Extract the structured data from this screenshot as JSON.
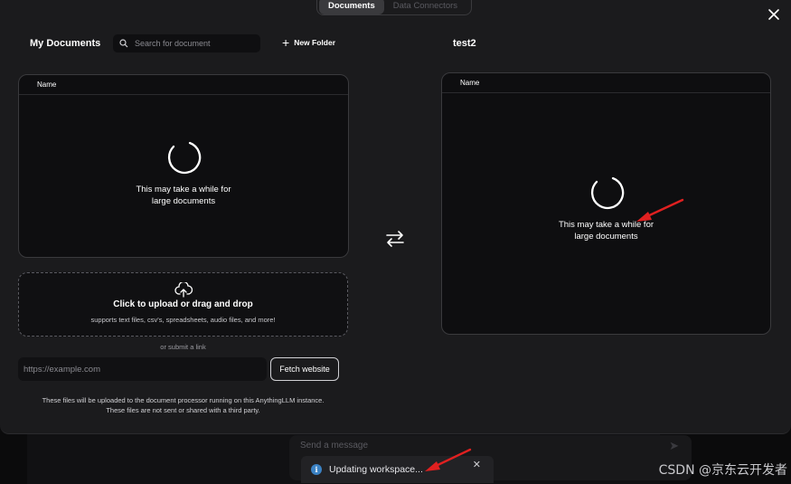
{
  "tabs": [
    {
      "label": "Documents",
      "active": true
    },
    {
      "label": "Data Connectors",
      "active": false
    }
  ],
  "left": {
    "title": "My Documents",
    "search_placeholder": "Search for document",
    "new_folder_label": "New Folder",
    "table_header": "Name",
    "loading_line1": "This may take a while for",
    "loading_line2": "large documents"
  },
  "right": {
    "title": "test2",
    "table_header": "Name",
    "loading_line1": "This may take a while for",
    "loading_line2": "large documents"
  },
  "upload": {
    "main_text": "Click to upload or drag and drop",
    "sub_text": "supports text files, csv's, spreadsheets, audio files, and more!",
    "or_link": "or submit a link",
    "url_placeholder": "https://example.com",
    "fetch_label": "Fetch website"
  },
  "disclaimer": {
    "line1": "These files will be uploaded to the document processor running on this AnythingLLM instance.",
    "line2": "These files are not sent or shared with a third party."
  },
  "chat": {
    "placeholder": "Send a message"
  },
  "toast": {
    "text": "Updating workspace...",
    "icon": "info-icon",
    "color": "#3b82c4"
  },
  "watermark": "CSDN @京东云开发者",
  "colors": {
    "arrow": "#e02020",
    "modal_bg": "#1b1b1d",
    "panel_bg": "#0e0e10"
  }
}
